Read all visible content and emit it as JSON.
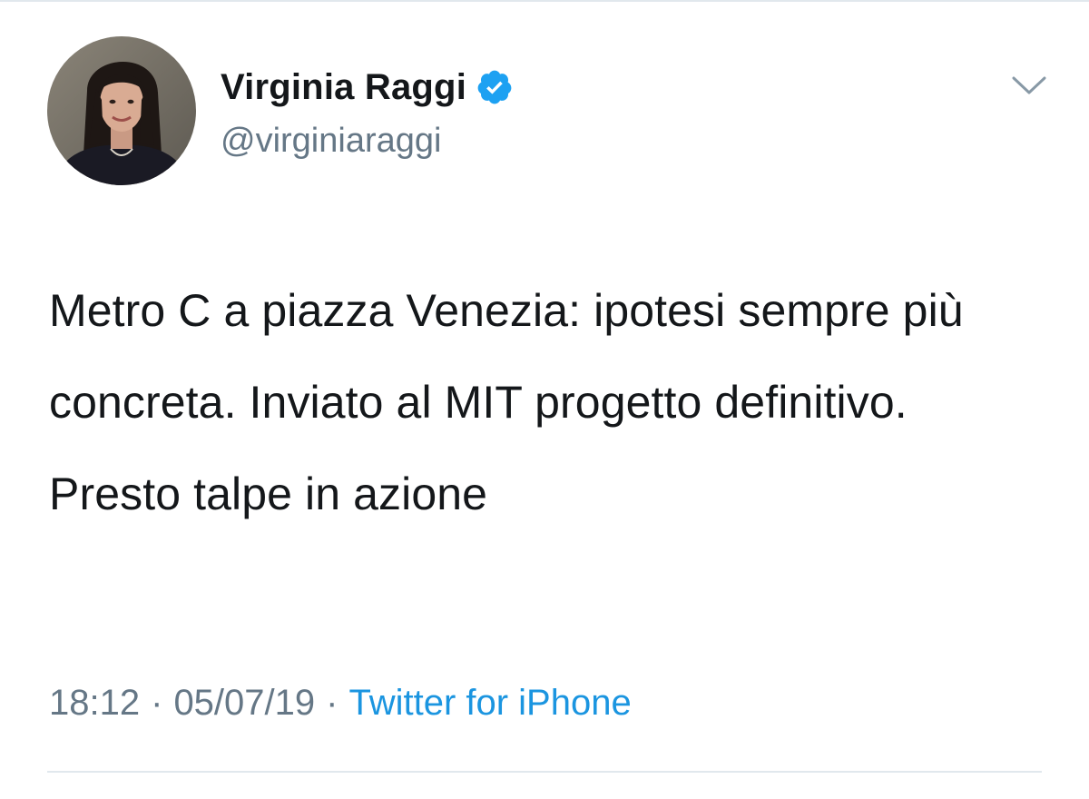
{
  "tweet": {
    "author": {
      "display_name": "Virginia Raggi",
      "handle": "@virginiaraggi",
      "verified": true,
      "avatar_icon": "user-avatar"
    },
    "text": "Metro C a piazza Venezia: ipotesi sempre più concreta. Inviato al MIT progetto definitivo. Presto talpe in azione",
    "meta": {
      "time": "18:12",
      "separator": "·",
      "date": "05/07/19",
      "source": "Twitter for iPhone"
    },
    "menu_icon": "chevron-down-icon"
  },
  "colors": {
    "text_primary": "#14171a",
    "text_secondary": "#657786",
    "link": "#1b95e0",
    "verified_badge": "#1da1f2",
    "divider": "#e1e8ed"
  }
}
